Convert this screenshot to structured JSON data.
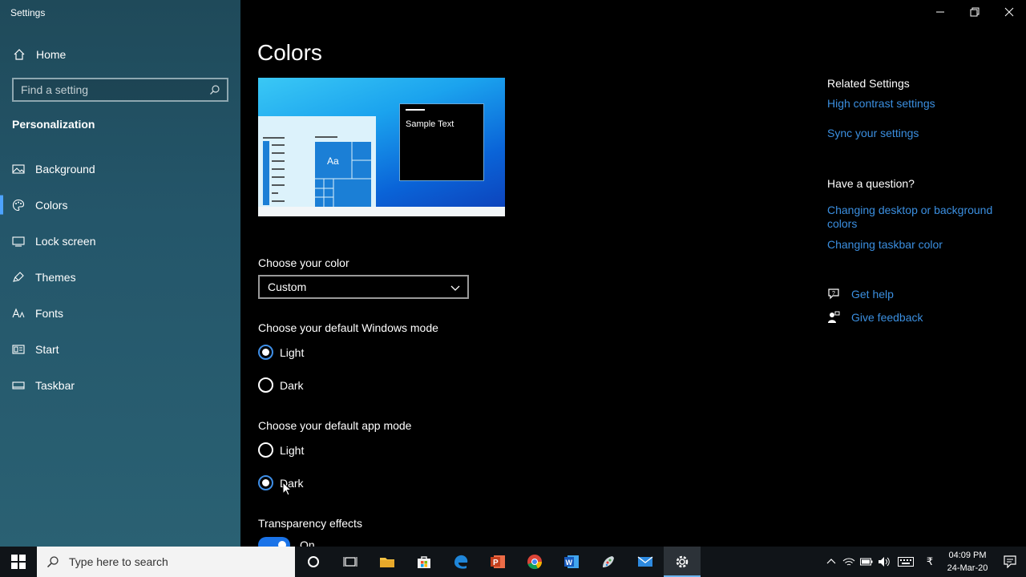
{
  "window": {
    "title": "Settings",
    "controls": {
      "minimize": "minimize",
      "maximize": "restore",
      "close": "close"
    }
  },
  "sidebar": {
    "home_label": "Home",
    "search_placeholder": "Find a setting",
    "section": "Personalization",
    "items": [
      {
        "label": "Background",
        "icon": "picture-icon"
      },
      {
        "label": "Colors",
        "icon": "palette-icon",
        "active": true
      },
      {
        "label": "Lock screen",
        "icon": "lock-screen-icon"
      },
      {
        "label": "Themes",
        "icon": "brush-icon"
      },
      {
        "label": "Fonts",
        "icon": "font-icon"
      },
      {
        "label": "Start",
        "icon": "start-icon"
      },
      {
        "label": "Taskbar",
        "icon": "taskbar-icon"
      }
    ]
  },
  "main": {
    "title": "Colors",
    "preview": {
      "sample_text": "Sample Text",
      "tile_text": "Aa"
    },
    "choose_color": {
      "label": "Choose your color",
      "value": "Custom"
    },
    "windows_mode": {
      "label": "Choose your default Windows mode",
      "options": [
        "Light",
        "Dark"
      ],
      "selected": "Light"
    },
    "app_mode": {
      "label": "Choose your default app mode",
      "options": [
        "Light",
        "Dark"
      ],
      "selected": "Dark"
    },
    "transparency": {
      "label": "Transparency effects",
      "state": "On"
    }
  },
  "rail": {
    "related_heading": "Related Settings",
    "related_links": [
      "High contrast settings",
      "Sync your settings"
    ],
    "question_heading": "Have a question?",
    "question_links": [
      "Changing desktop or background colors",
      "Changing taskbar color"
    ],
    "help": {
      "get_help": "Get help",
      "give_feedback": "Give feedback"
    }
  },
  "taskbar": {
    "search_placeholder": "Type here to search",
    "apps": [
      "cortana-icon",
      "task-view-icon",
      "file-explorer-icon",
      "store-icon",
      "edge-icon",
      "powerpoint-icon",
      "chrome-icon",
      "word-icon",
      "paint-icon",
      "mail-icon",
      "settings-icon"
    ],
    "clock": {
      "time": "04:09 PM",
      "date": "24-Mar-20"
    },
    "tray_lang": "₹"
  },
  "colors": {
    "accent": "#3b8fe0",
    "sidebar": "#24566a",
    "background": "#000000"
  }
}
